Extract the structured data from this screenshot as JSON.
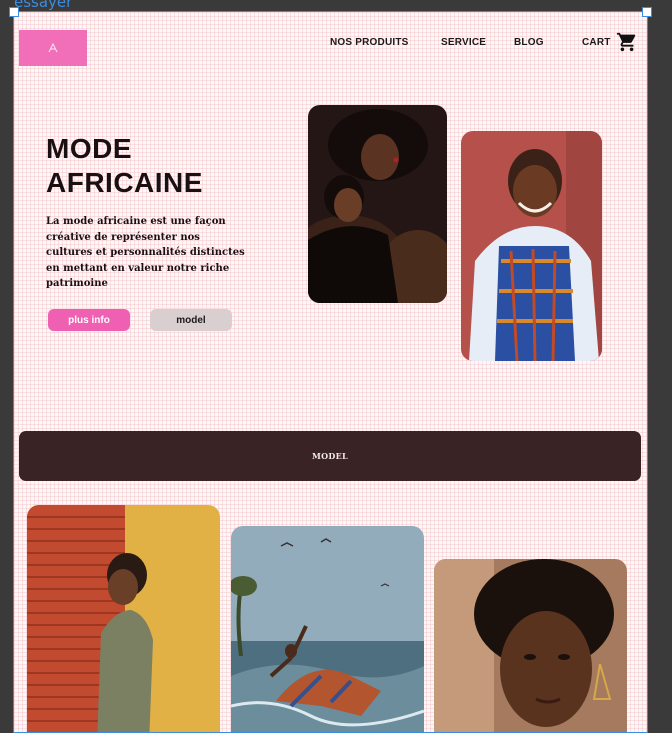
{
  "editor": {
    "frame_label": "essayer"
  },
  "nav": {
    "items": [
      {
        "label": "NOS PRODUITS"
      },
      {
        "label": "SERVICE"
      },
      {
        "label": "BLOG"
      },
      {
        "label": "CART"
      }
    ]
  },
  "hero": {
    "title_line1": "MODE",
    "title_line2": "AFRICAINE",
    "description": "La mode africaine est une façon créative de représenter nos cultures et personnalités distinctes en mettant en valeur notre riche patrimoine",
    "primary_button": "plus info",
    "secondary_button": "model"
  },
  "banner": {
    "text": "MODEL"
  },
  "icons": {
    "cart": "cart-icon",
    "logo": "brand-logo",
    "photos": [
      "two-women-photo",
      "smiling-woman-patterned-dress-photo",
      "man-orange-shutter-photo",
      "woman-dancing-beach-photo",
      "woman-portrait-earrings-photo"
    ]
  },
  "colors": {
    "accent_pink": "#ef5fb2",
    "logo_pink": "#f06fb8",
    "banner_dark": "#3a2325",
    "secondary_button": "#d9cfd0",
    "frame_outline": "#3b8de0"
  }
}
